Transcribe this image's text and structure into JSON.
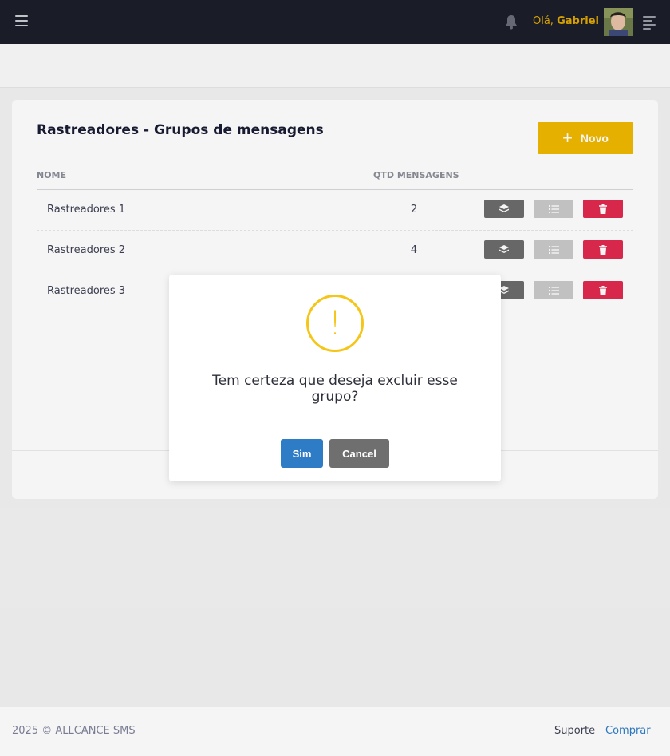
{
  "header": {
    "greeting_prefix": "Olá,",
    "user_name": "Gabriel"
  },
  "card": {
    "title": "Rastreadores - Grupos de mensagens",
    "new_button_label": "Novo",
    "columns": [
      "NOME",
      "QTD MENSAGENS"
    ],
    "rows": [
      {
        "name": "Rastreadores 1",
        "qty": "2"
      },
      {
        "name": "Rastreadores 2",
        "qty": "4"
      },
      {
        "name": "Rastreadores 3",
        "qty": ""
      }
    ]
  },
  "modal": {
    "icon_text": "!",
    "title": "Tem certeza que deseja excluir esse grupo?",
    "confirm_label": "Sim",
    "cancel_label": "Cancel"
  },
  "footer": {
    "copyright": "2025 © ALLCANCE SMS",
    "support_link": "Suporte",
    "buy_link": "Comprar"
  },
  "colors": {
    "accent_yellow": "#f0b800",
    "danger": "#e0294f",
    "primary_blue": "#2f7cc6",
    "topbar": "#1c1e2a"
  }
}
